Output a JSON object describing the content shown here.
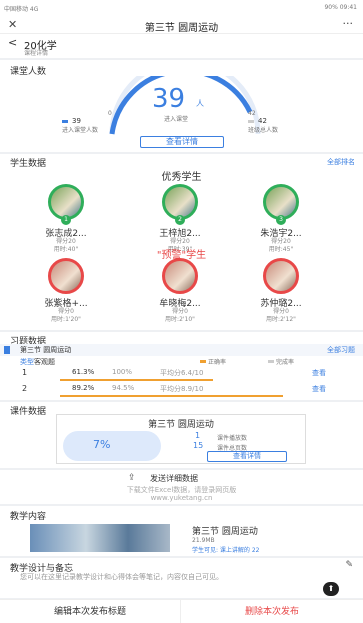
{
  "status_bar": {
    "left": "中国移动 4G",
    "right": "90% 09:41"
  },
  "top_bar": {
    "close": "✕",
    "title": "第三节 圆周运动",
    "more": "···"
  },
  "sub_bar": {
    "back": "<",
    "class_name": "20化学",
    "subtitle": "课程详情"
  },
  "attendance": {
    "title": "课堂人数",
    "count": "39",
    "count_unit": "人",
    "count_label": "进入课堂",
    "left_num": "39",
    "left_label": "进入课堂人数",
    "right_num": "42",
    "right_label": "班级总人数",
    "left_tick": "0",
    "right_tick": "42",
    "detail_button": "查看详情"
  },
  "students": {
    "title": "学生数据",
    "link": "全部排名",
    "excellent_title": "优秀学生",
    "warning_title": "\"预警\"学生",
    "excellent": [
      {
        "name": "张志成2...",
        "score": "得分20",
        "time": "用时:40\""
      },
      {
        "name": "王梓旭2...",
        "score": "得分20",
        "time": "用时:39\""
      },
      {
        "name": "朱浩宇2...",
        "score": "得分20",
        "time": "用时:45\""
      }
    ],
    "warning": [
      {
        "name": "张紫格+...",
        "score": "得分0",
        "time": "用时:1'20\""
      },
      {
        "name": "牟晓梅2...",
        "score": "得分0",
        "time": "用时:2'10\""
      },
      {
        "name": "苏仲璐2...",
        "score": "得分0",
        "time": "用时:2'12\""
      }
    ]
  },
  "exercise": {
    "title": "习题数据",
    "lesson": "第三节 圆周运动",
    "link": "全部习题",
    "col_type": "类型",
    "filter_label": "客观题",
    "legend_correct": "正确率",
    "legend_rate": "完成率",
    "rows": [
      {
        "num": "1",
        "correct": "61.3%",
        "rate": "100%",
        "avg": "平均分6.4/10",
        "link": "查看",
        "fill": 0.61
      },
      {
        "num": "2",
        "correct": "89.2%",
        "rate": "94.5%",
        "avg": "平均分8.9/10",
        "link": "查看",
        "fill": 0.89
      }
    ]
  },
  "courseware": {
    "title": "课件数据",
    "lesson": "第三节 圆周运动",
    "percent": "7%",
    "stat1_num": "1",
    "stat1_label": "课件播放数",
    "stat2_num": "15",
    "stat2_label": "课件总页数",
    "detail_button": "查看详情"
  },
  "report": {
    "label": "发送详细数据",
    "line1": "下载文件Excel数据，请登录网页版",
    "line2": "www.yuketang.cn"
  },
  "teaching": {
    "title": "教学内容",
    "lesson": "第三节 圆周运动",
    "size": "21.9MB",
    "meta": "学生可见: 课上讲解的 22"
  },
  "reflection": {
    "title": "教学设计与备忘",
    "text": "您可以在这里记录教学设计和心得体会等笔记，内容仅自己可见。"
  },
  "bottom": {
    "left": "编辑本次发布标题",
    "right": "删除本次发布"
  },
  "colors": {
    "accent": "#3b7fe0",
    "orange": "#f0a030",
    "green": "#2fae5a",
    "red": "#e84848"
  }
}
